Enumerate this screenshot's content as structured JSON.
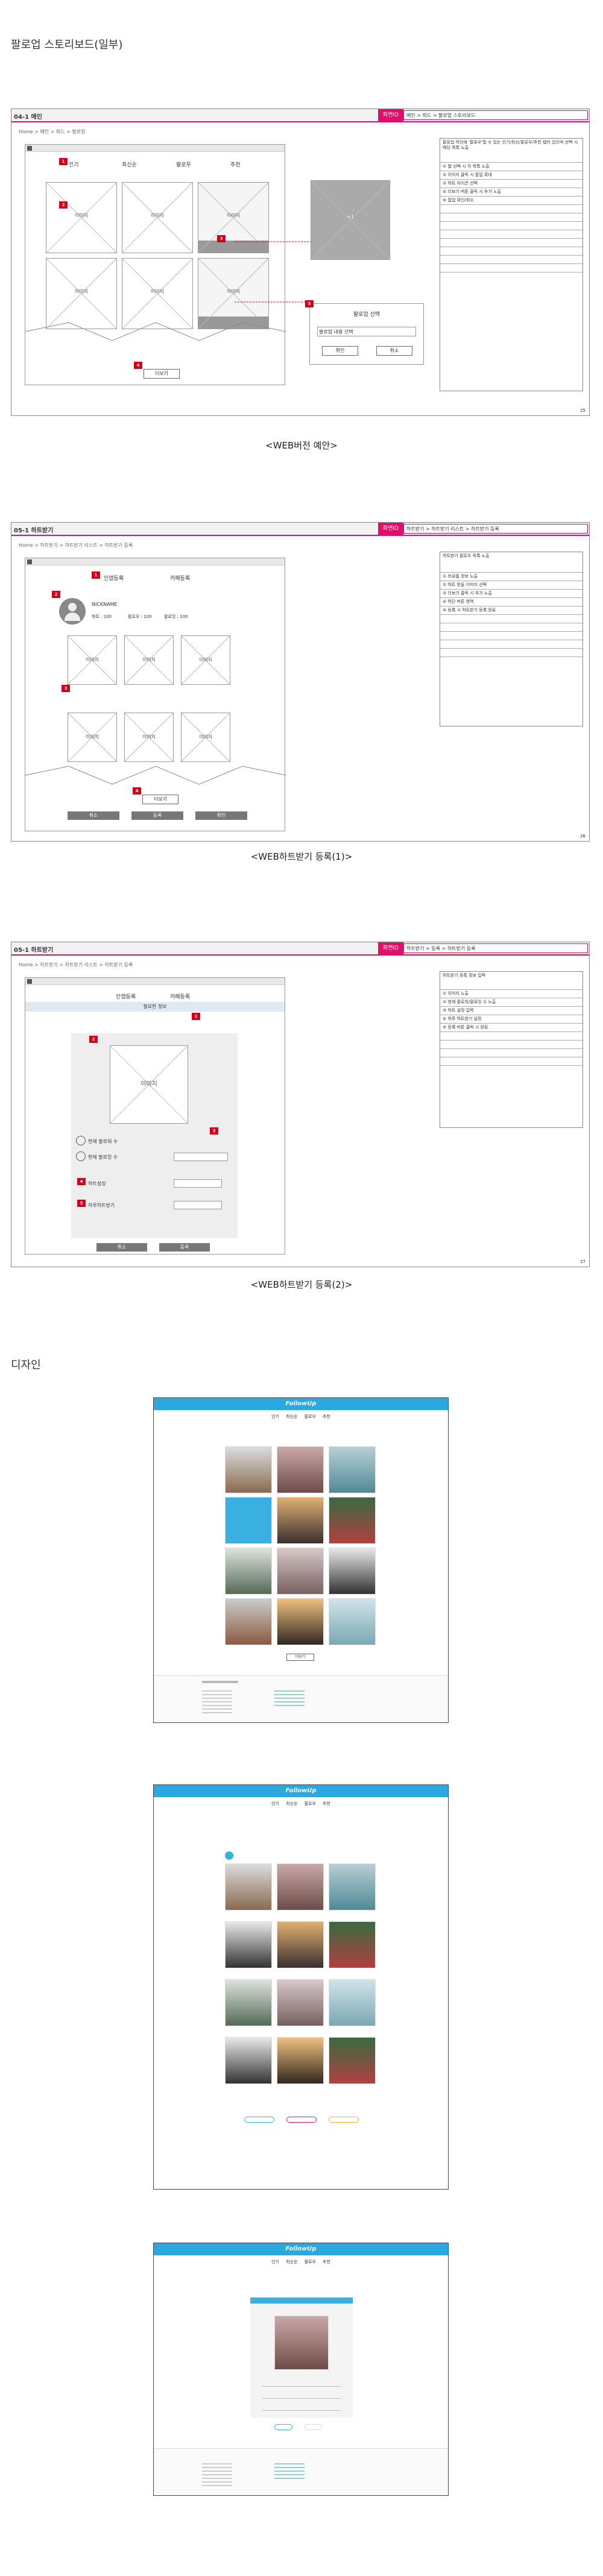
{
  "page_title": "팔로업 스토리보드(일부)",
  "section_design": "디자인",
  "sb1": {
    "code": "04-1 메인",
    "tag": "화면ID",
    "path": "메인 > 피드 > 팔로업 스토리보드",
    "crumb": "Home > 메인 > 피드 > 팔로업",
    "tabs": [
      "인기",
      "최신순",
      "팔로우",
      "추천"
    ],
    "thumbs": [
      "이미지",
      "이미지",
      "이미지",
      "이미지",
      "이미지",
      "이미지"
    ],
    "more": "더보기",
    "zoom_label": "+1",
    "popup_title": "팔로업 선택",
    "popup_input": "팔로업 내용 선택",
    "popup_ok": "확인",
    "popup_cancel": "취소",
    "notes": [
      "팔로업 하단에 '팔로우'할 수 있는 인기/최신/팔로우/추천 탭이 있으며 선택 시 해당 목록 노출",
      "① 탭 선택 시 각 목록 노출",
      "② 이미지 클릭 시 팝업 확대",
      "③ 하트 아이콘 선택",
      "④ 더보기 버튼 클릭 시 추가 노출",
      "⑤ 팝업 확인/취소"
    ],
    "page": "25",
    "caption": "<WEB버전 예안>"
  },
  "sb2": {
    "code": "05-1 하트받기",
    "tag": "화면ID",
    "path": "하트받기 > 하트받기 리스트 > 하트받기 등록",
    "crumb": "Home > 하트받기 > 하트받기 리스트 > 하트받기 등록",
    "tabs": [
      "인앱등록",
      "카페등록"
    ],
    "profile_name": "NICKNAME",
    "stats": [
      "하트 : 100",
      "팔로우 : 100",
      "팔로잉 : 100"
    ],
    "thumbs": [
      "이미지",
      "이미지",
      "이미지",
      "이미지",
      "이미지",
      "이미지"
    ],
    "more": "더보기",
    "btns": [
      "취소",
      "등록",
      "확인"
    ],
    "notes": [
      "하트받기 팔로우 목록 노출",
      "① 프로필 정보 노출",
      "② 하트 받을 이미지 선택",
      "③ 더보기 클릭 시 추가 노출",
      "④ 하단 버튼 영역",
      "⑤ 등록 시 하트받기 등록 완료"
    ],
    "page": "26",
    "caption": "<WEB하트받기 등록(1)>"
  },
  "sb3": {
    "code": "05-1 하트받기",
    "tag": "화면ID",
    "path": "하트받기 > 등록 > 하트받기 등록",
    "crumb": "Home > 하트받기 > 하트받기 리스트 > 하트받기 등록",
    "tabs": [
      "인앱등록",
      "카페등록"
    ],
    "form_title": "필요한 정보",
    "img_label": "이미지",
    "rows": [
      "현재 팔로워 수",
      "현재 팔로잉 수",
      "하트설정",
      "하루하트받기"
    ],
    "btns": [
      "취소",
      "등록"
    ],
    "notes": [
      "하트받기 등록 정보 입력",
      "① 이미지 노출",
      "② 현재 팔로워/팔로잉 수 노출",
      "③ 하트 설정 입력",
      "④ 하루 하트받기 설정",
      "⑤ 등록 버튼 클릭 시 완료"
    ],
    "page": "27",
    "caption": "<WEB하트받기 등록(2)>"
  },
  "design": {
    "logo": "FollowUp",
    "nav": [
      "인기",
      "최신순",
      "팔로우",
      "추천"
    ],
    "more": "더보기",
    "colors": {
      "brand": "#2aa8e0",
      "accent": "#e0106a"
    }
  }
}
